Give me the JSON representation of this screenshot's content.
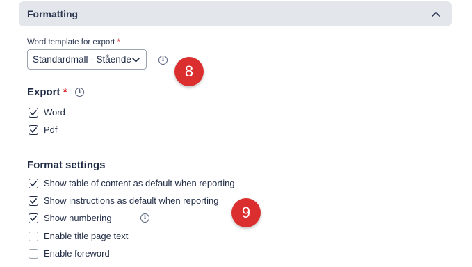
{
  "section": {
    "title": "Formatting"
  },
  "word_template": {
    "label": "Word template for export",
    "required_mark": "*",
    "selected": "Standardmall - Stående"
  },
  "export": {
    "heading": "Export",
    "required_mark": "*",
    "options": [
      {
        "label": "Word",
        "checked": true
      },
      {
        "label": "Pdf",
        "checked": true
      }
    ]
  },
  "format_settings": {
    "heading": "Format settings",
    "options": [
      {
        "label": "Show table of content as default when reporting",
        "checked": true
      },
      {
        "label": "Show instructions as default when reporting",
        "checked": true
      },
      {
        "label": "Show numbering",
        "checked": true
      },
      {
        "label": "Enable title page text",
        "checked": false
      },
      {
        "label": "Enable foreword",
        "checked": false
      }
    ]
  },
  "annotations": {
    "badge_8": "8",
    "badge_9": "9"
  },
  "colors": {
    "header_bg": "#e3e6eb",
    "text": "#1f2a44",
    "required": "#d8232a",
    "badge": "#db2f2f"
  }
}
